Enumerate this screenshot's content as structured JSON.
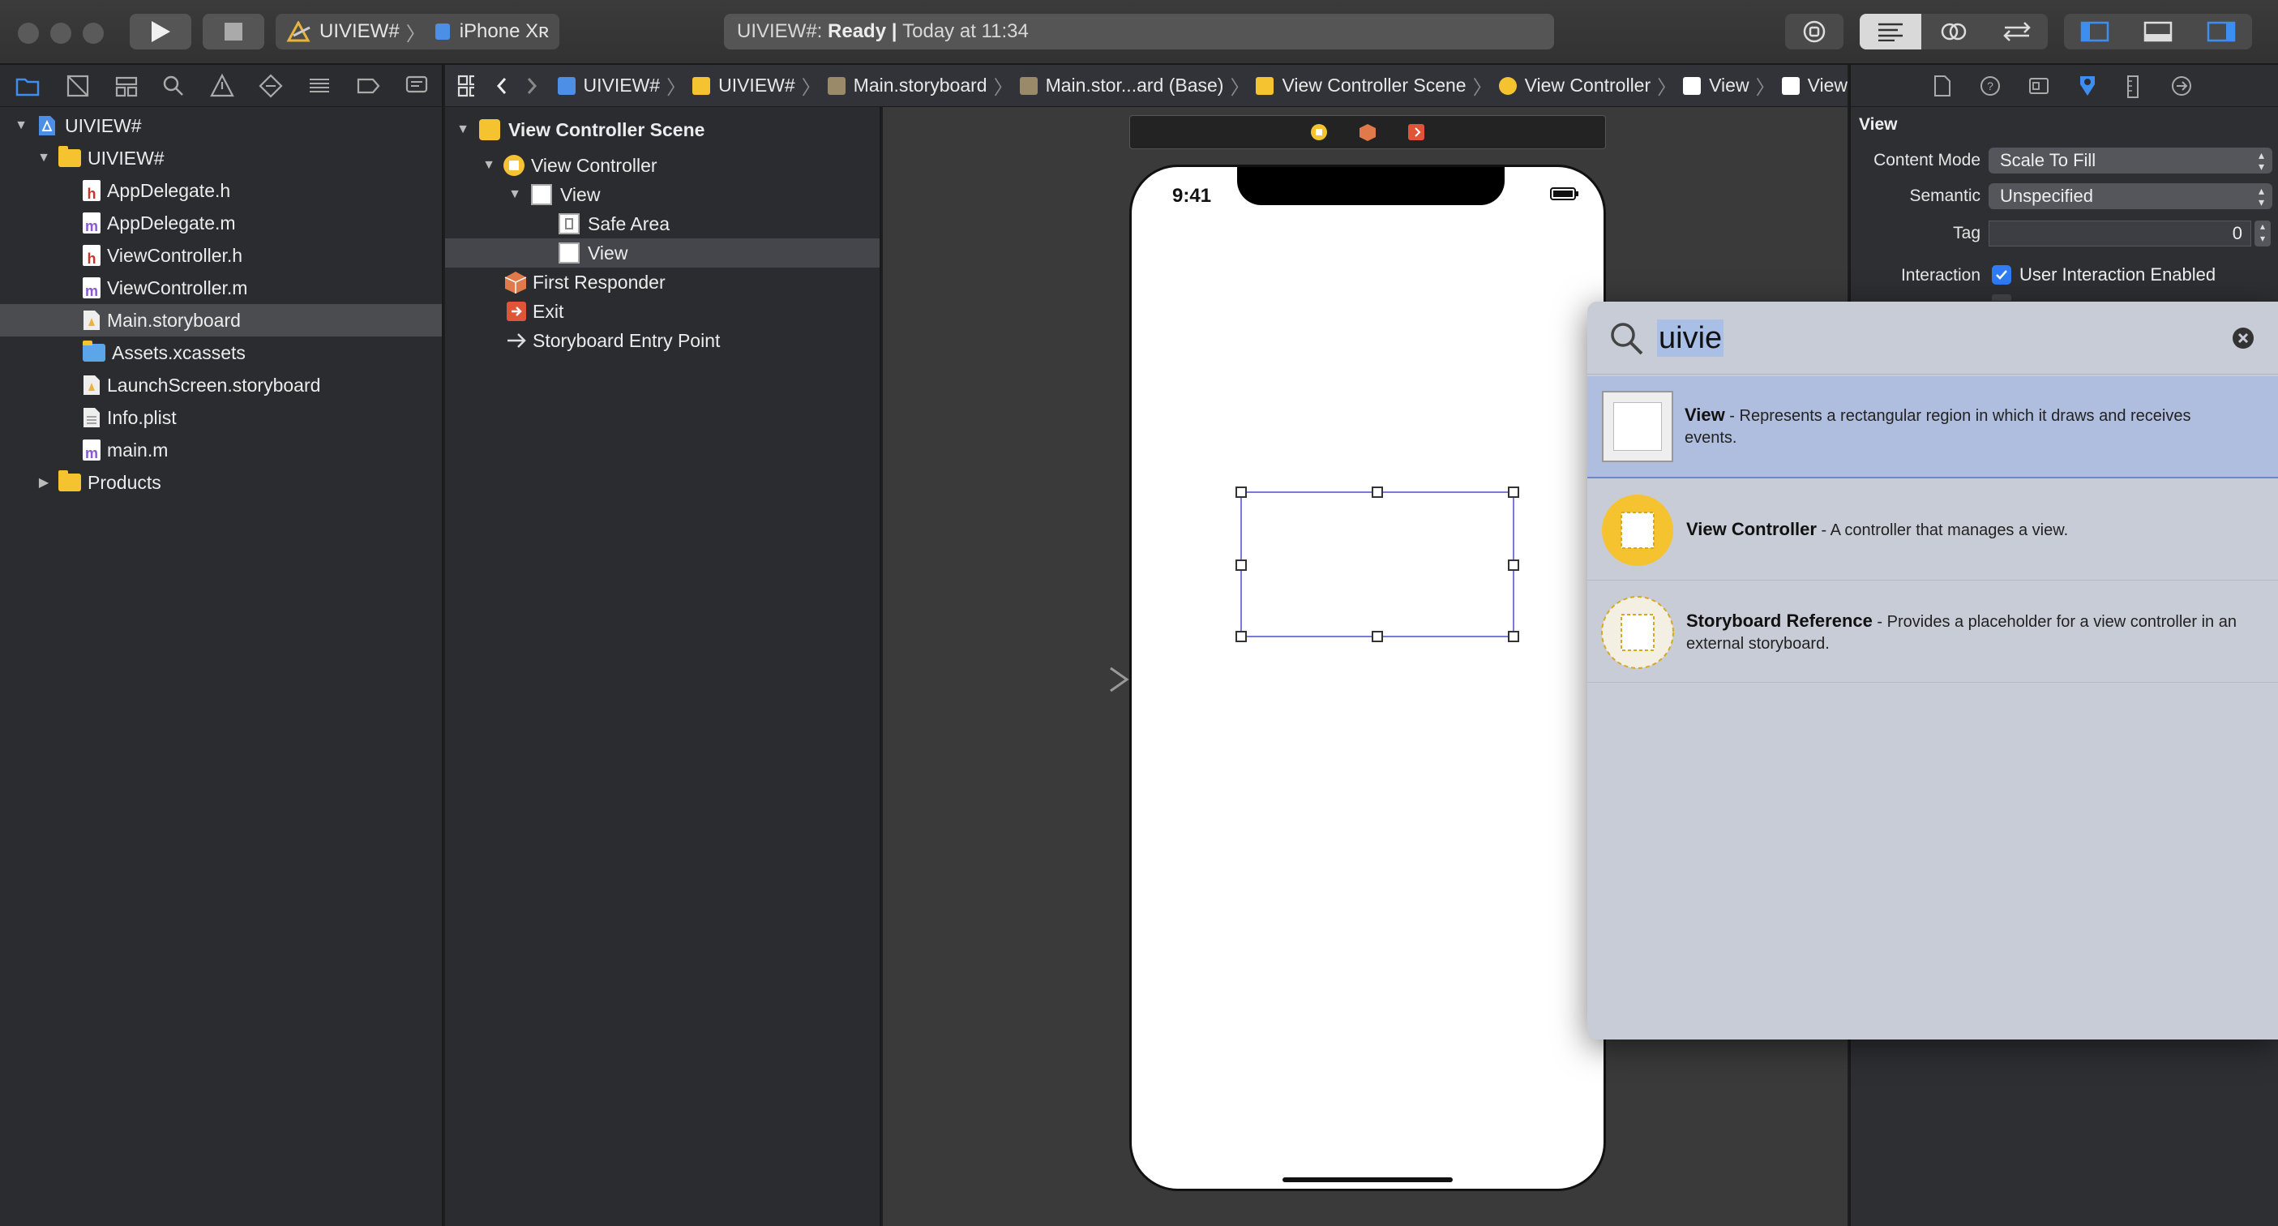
{
  "toolbar": {
    "scheme_name": "UIVIEW#",
    "device_name": "iPhone Xʀ",
    "activity_project": "UIVIEW#:",
    "activity_status": "Ready",
    "activity_separator": "|",
    "activity_time": "Today at 11:34"
  },
  "navigator": {
    "items": [
      {
        "label": "UIVIEW#"
      },
      {
        "label": "UIVIEW#"
      },
      {
        "label": "AppDelegate.h",
        "badge": "h"
      },
      {
        "label": "AppDelegate.m",
        "badge": "m"
      },
      {
        "label": "ViewController.h",
        "badge": "h"
      },
      {
        "label": "ViewController.m",
        "badge": "m"
      },
      {
        "label": "Main.storyboard"
      },
      {
        "label": "Assets.xcassets"
      },
      {
        "label": "LaunchScreen.storyboard"
      },
      {
        "label": "Info.plist"
      },
      {
        "label": "main.m",
        "badge": "m"
      },
      {
        "label": "Products"
      }
    ]
  },
  "jumpbar": {
    "crumbs": [
      "UIVIEW#",
      "UIVIEW#",
      "Main.storyboard",
      "Main.stor...ard (Base)",
      "View Controller Scene",
      "View Controller",
      "View",
      "View"
    ]
  },
  "outline": {
    "items": [
      {
        "label": "View Controller Scene"
      },
      {
        "label": "View Controller"
      },
      {
        "label": "View"
      },
      {
        "label": "Safe Area"
      },
      {
        "label": "View"
      },
      {
        "label": "First Responder"
      },
      {
        "label": "Exit"
      },
      {
        "label": "Storyboard Entry Point"
      }
    ]
  },
  "canvas": {
    "status_time": "9:41"
  },
  "inspector": {
    "section_title": "View",
    "content_mode_label": "Content Mode",
    "content_mode_value": "Scale To Fill",
    "semantic_label": "Semantic",
    "semantic_value": "Unspecified",
    "tag_label": "Tag",
    "tag_value": "0",
    "interaction_label": "Interaction",
    "user_interaction_label": "User Interaction Enabled"
  },
  "library": {
    "search_value": "uivie",
    "items": [
      {
        "title": "View",
        "desc": " - Represents a rectangular region in which it draws and receives events."
      },
      {
        "title": "View Controller",
        "desc": " - A controller that manages a view."
      },
      {
        "title": "Storyboard Reference",
        "desc": " - Provides a placeholder for a view controller in an external storyboard."
      }
    ]
  },
  "colors": {
    "selection_accent": "#7a7ad8",
    "library_selected": "#afbddf",
    "checkbox_blue": "#2f7cf6",
    "view_controller_yellow": "#f5c230"
  }
}
